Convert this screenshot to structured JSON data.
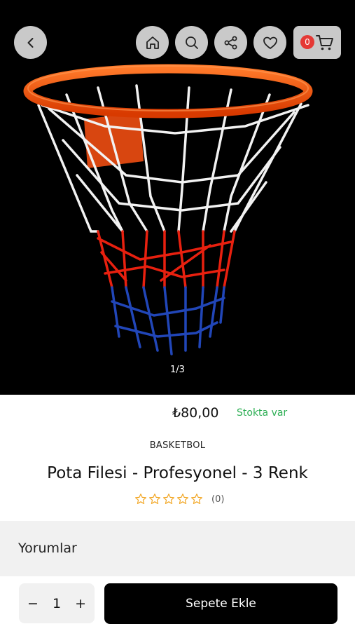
{
  "gallery": {
    "pager": "1/3"
  },
  "header": {
    "cart_count": "0"
  },
  "product": {
    "price": "₺80,00",
    "stock_status": "Stokta var",
    "category": "BASKETBOL",
    "title": "Pota Filesi - Profesyonel - 3 Renk",
    "rating_count": "(0)",
    "rating_value": 0,
    "rating_max": 5
  },
  "reviews": {
    "title": "Yorumlar"
  },
  "cart_bar": {
    "minus": "−",
    "quantity": "1",
    "plus": "+",
    "add_to_cart": "Sepete Ekle"
  },
  "colors": {
    "stock_green": "#2eaf55",
    "badge_red": "#e53935",
    "rim_orange": "#ff5a12"
  }
}
